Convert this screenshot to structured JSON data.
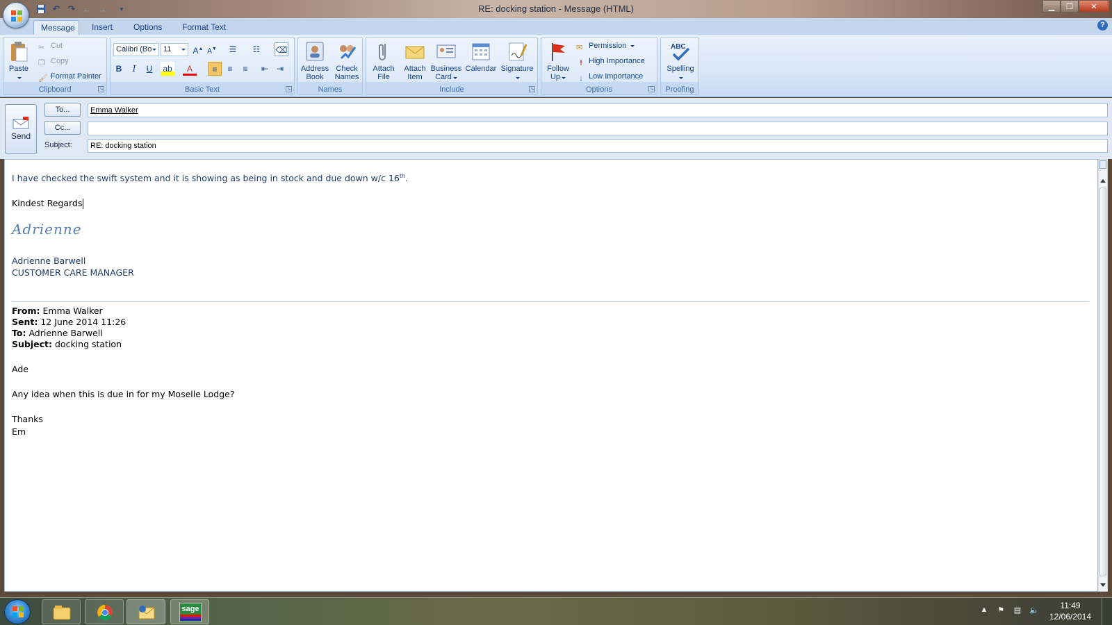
{
  "window": {
    "title": "RE: docking station - Message (HTML)"
  },
  "tabs": [
    {
      "label": "Message",
      "active": true
    },
    {
      "label": "Insert",
      "active": false
    },
    {
      "label": "Options",
      "active": false
    },
    {
      "label": "Format Text",
      "active": false
    }
  ],
  "ribbon": {
    "clipboard": {
      "paste": "Paste",
      "cut": "Cut",
      "copy": "Copy",
      "format_painter": "Format Painter",
      "label": "Clipboard"
    },
    "basic_text": {
      "font_name": "Calibri (Bo",
      "font_size": "11",
      "label": "Basic Text"
    },
    "names": {
      "address_book_line1": "Address",
      "address_book_line2": "Book",
      "check_names_line1": "Check",
      "check_names_line2": "Names",
      "label": "Names"
    },
    "include": {
      "attach_file_line1": "Attach",
      "attach_file_line2": "File",
      "attach_item_line1": "Attach",
      "attach_item_line2": "Item",
      "business_card_line1": "Business",
      "business_card_line2": "Card",
      "calendar": "Calendar",
      "signature": "Signature",
      "label": "Include"
    },
    "options": {
      "follow_up_line1": "Follow",
      "follow_up_line2": "Up",
      "permission": "Permission",
      "high_importance": "High Importance",
      "low_importance": "Low Importance",
      "label": "Options"
    },
    "proofing": {
      "spelling": "Spelling",
      "spelling_icon_text": "ABC",
      "label": "Proofing"
    }
  },
  "header": {
    "send": "Send",
    "to_button": "To...",
    "cc_button": "Cc...",
    "subject_label": "Subject:",
    "to_value": "Emma Walker",
    "cc_value": "",
    "subject_value": "RE: docking station"
  },
  "body": {
    "line1_main": "I have checked the swift system and it is showing as being in stock and due down w/c 16",
    "line1_sup": "th",
    "line1_end": ".",
    "regards": "Kindest Regards",
    "signature_script": "Adrienne",
    "sender_name": "Adrienne Barwell",
    "sender_title": "CUSTOMER CARE MANAGER",
    "quoted": {
      "from_label": "From:",
      "from_value": "Emma Walker",
      "sent_label": "Sent:",
      "sent_value": "12 June 2014 11:26",
      "to_label": "To:",
      "to_value": "Adrienne Barwell",
      "subject_label": "Subject:",
      "subject_value": "docking station",
      "greeting": "Ade",
      "question": "Any idea when this is due in for my Moselle Lodge?",
      "thanks": "Thanks",
      "signoff": "Em"
    }
  },
  "taskbar": {
    "time": "11:49",
    "date": "12/06/2014",
    "sage_label": "sage"
  },
  "colors": {
    "ribbon_text": "#15428b",
    "body_blue": "#1f3864",
    "signature_blue": "#5a7fa8"
  }
}
